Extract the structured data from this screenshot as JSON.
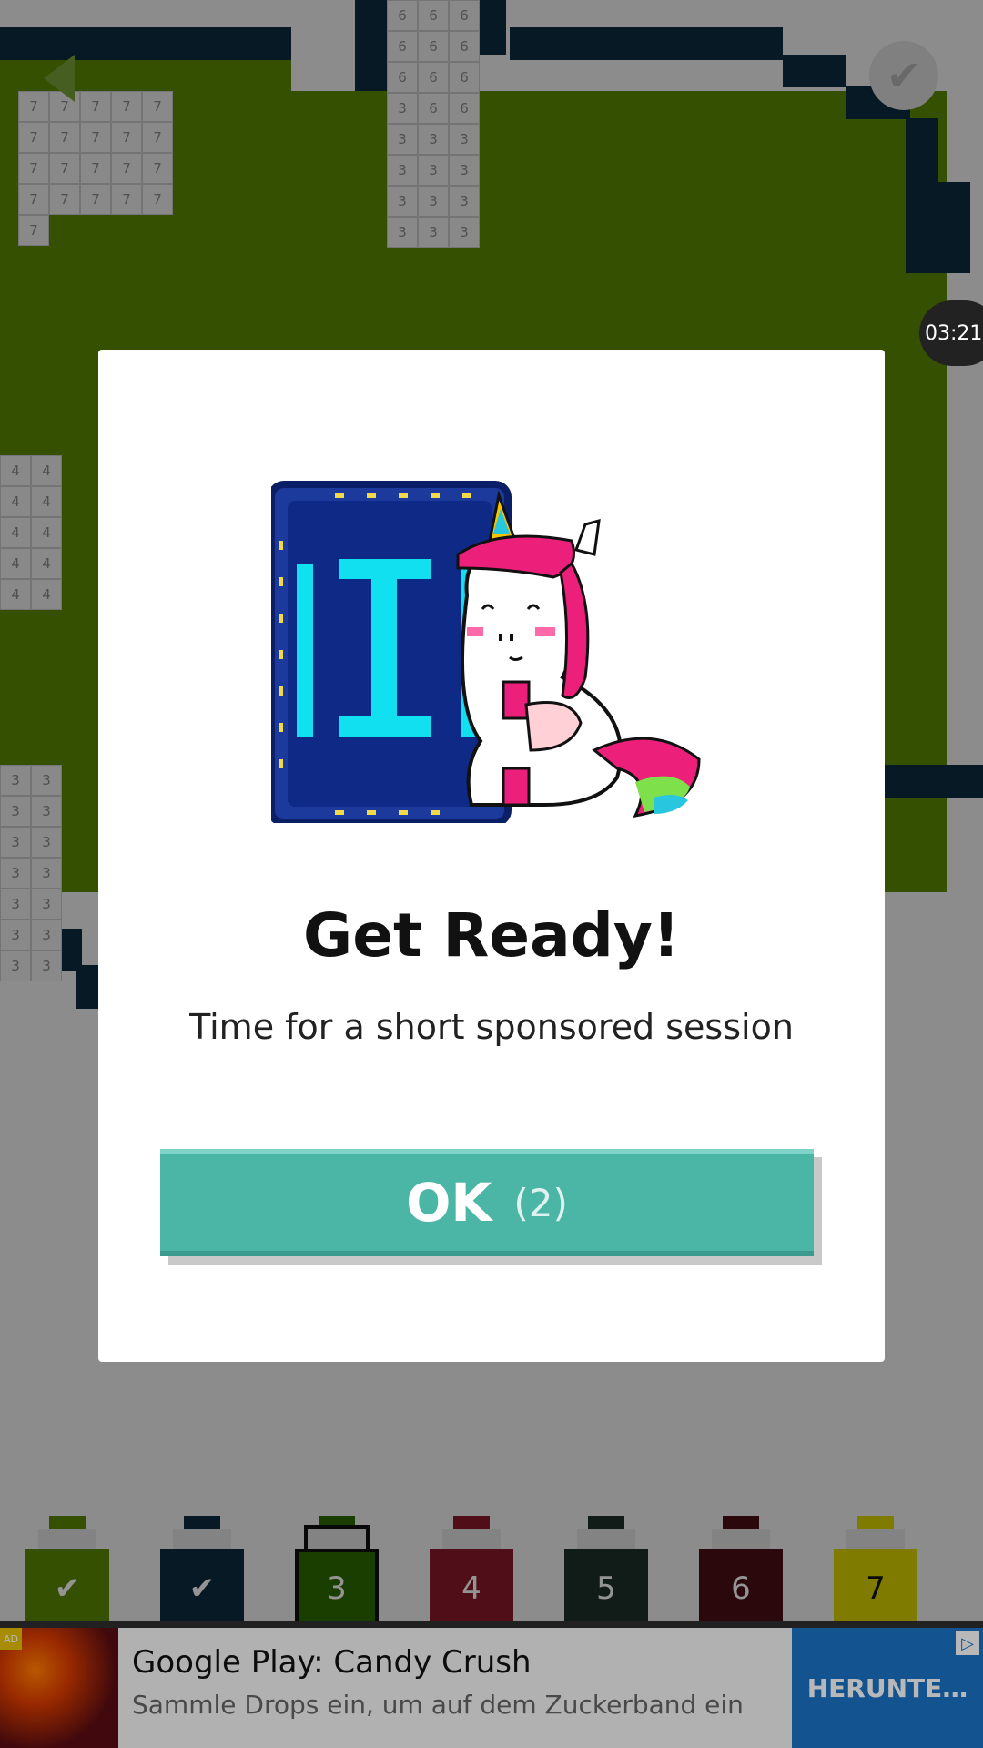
{
  "timer": "03:21",
  "modal": {
    "title": "Get Ready!",
    "subtitle": "Time for a short sponsored session",
    "ok_label": "OK",
    "ok_countdown": "(2)"
  },
  "palette": [
    {
      "label": "✔",
      "color": "#5c8a00"
    },
    {
      "label": "✔",
      "color": "#0d2b40"
    },
    {
      "label": "3",
      "color": "#2d6b00",
      "selected": true
    },
    {
      "label": "4",
      "color": "#8a1a2a"
    },
    {
      "label": "5",
      "color": "#1e2f28"
    },
    {
      "label": "6",
      "color": "#4a0e14"
    },
    {
      "label": "7",
      "color": "#d9d400"
    }
  ],
  "grid_numbers": {
    "patch_6": [
      "6",
      "6",
      "6",
      "6",
      "6",
      "6",
      "6",
      "6",
      "6",
      "3",
      "6",
      "6",
      "3",
      "3",
      "3",
      "3",
      "3",
      "3",
      "3",
      "3",
      "3",
      "3",
      "3",
      "3"
    ],
    "patch_7": [
      "7",
      "7",
      "7",
      "7",
      "7",
      "7",
      "7",
      "7",
      "7",
      "7",
      "7",
      "7",
      "7",
      "7",
      "7",
      "7",
      "7",
      "7",
      "7",
      "7",
      "7"
    ],
    "patch_4": [
      "4",
      "4",
      "4",
      "4",
      "4",
      "4",
      "4",
      "4",
      "4",
      "4"
    ],
    "patch_3": [
      "3",
      "3",
      "3",
      "3",
      "3",
      "3",
      "3",
      "3",
      "3",
      "3",
      "3",
      "3",
      "3",
      "3"
    ]
  },
  "ad": {
    "badge": "AD",
    "title": "Google Play: Candy Crush",
    "description": "Sammle Drops ein, um auf dem Zuckerband ein",
    "cta": "HERUNTE…"
  },
  "icons": {
    "back": "back-arrow-icon",
    "done": "checkmark-icon",
    "adchoices": "adchoices-icon"
  }
}
